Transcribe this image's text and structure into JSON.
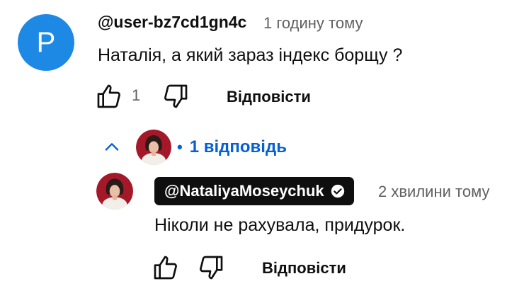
{
  "comment": {
    "avatar_letter": "P",
    "avatar_color": "#1e88e5",
    "author": "@user-bz7cd1gn4c",
    "time": "1 годину тому",
    "text": "Наталія, а який зараз індекс борщу ?",
    "like_count": "1",
    "like_icon": "thumb-up-icon",
    "dislike_icon": "thumb-down-icon",
    "reply_label": "Відповісти"
  },
  "replies_toggle": {
    "icon": "chevron-up-icon",
    "dot": "•",
    "label": "1 відповідь",
    "color": "#065fd4"
  },
  "reply": {
    "author": "@NataliyaMoseychuk",
    "verified_icon": "verified-check-icon",
    "time": "2 хвилини тому",
    "text": "Ніколи не рахувала, придурок.",
    "like_icon": "thumb-up-icon",
    "dislike_icon": "thumb-down-icon",
    "reply_label": "Відповісти"
  }
}
